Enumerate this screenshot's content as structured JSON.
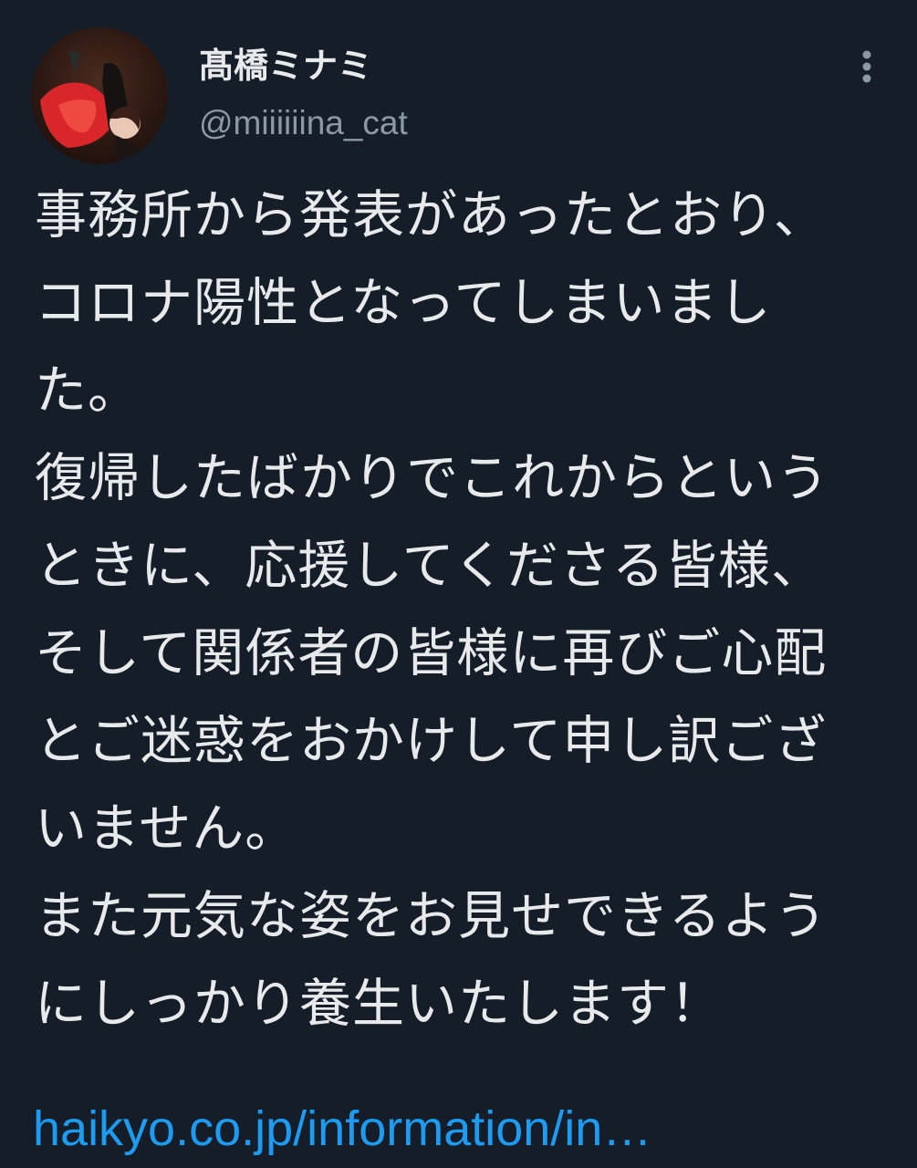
{
  "user": {
    "display_name": "髙橋ミナミ",
    "handle": "@miiiiiina_cat",
    "avatar_icon": "profile-photo"
  },
  "menu": {
    "icon": "more-vertical-icon"
  },
  "tweet": {
    "lines": [
      "事務所から発表があったとおり、",
      "コロナ陽性となってしまいまし",
      "た。",
      "復帰したばかりでこれからという",
      "ときに、応援してくださる皆様、",
      "そして関係者の皆様に再びご心配",
      "とご迷惑をおかけして申し訳ござ",
      "いません。",
      "また元気な姿をお見せできるよう",
      "にしっかり養生いたします！"
    ],
    "link": "haikyo.co.jp/information/in…"
  },
  "colors": {
    "background": "#151d28",
    "text": "#e7e9ea",
    "secondary": "#8b98a5",
    "link": "#1d9bf0"
  }
}
